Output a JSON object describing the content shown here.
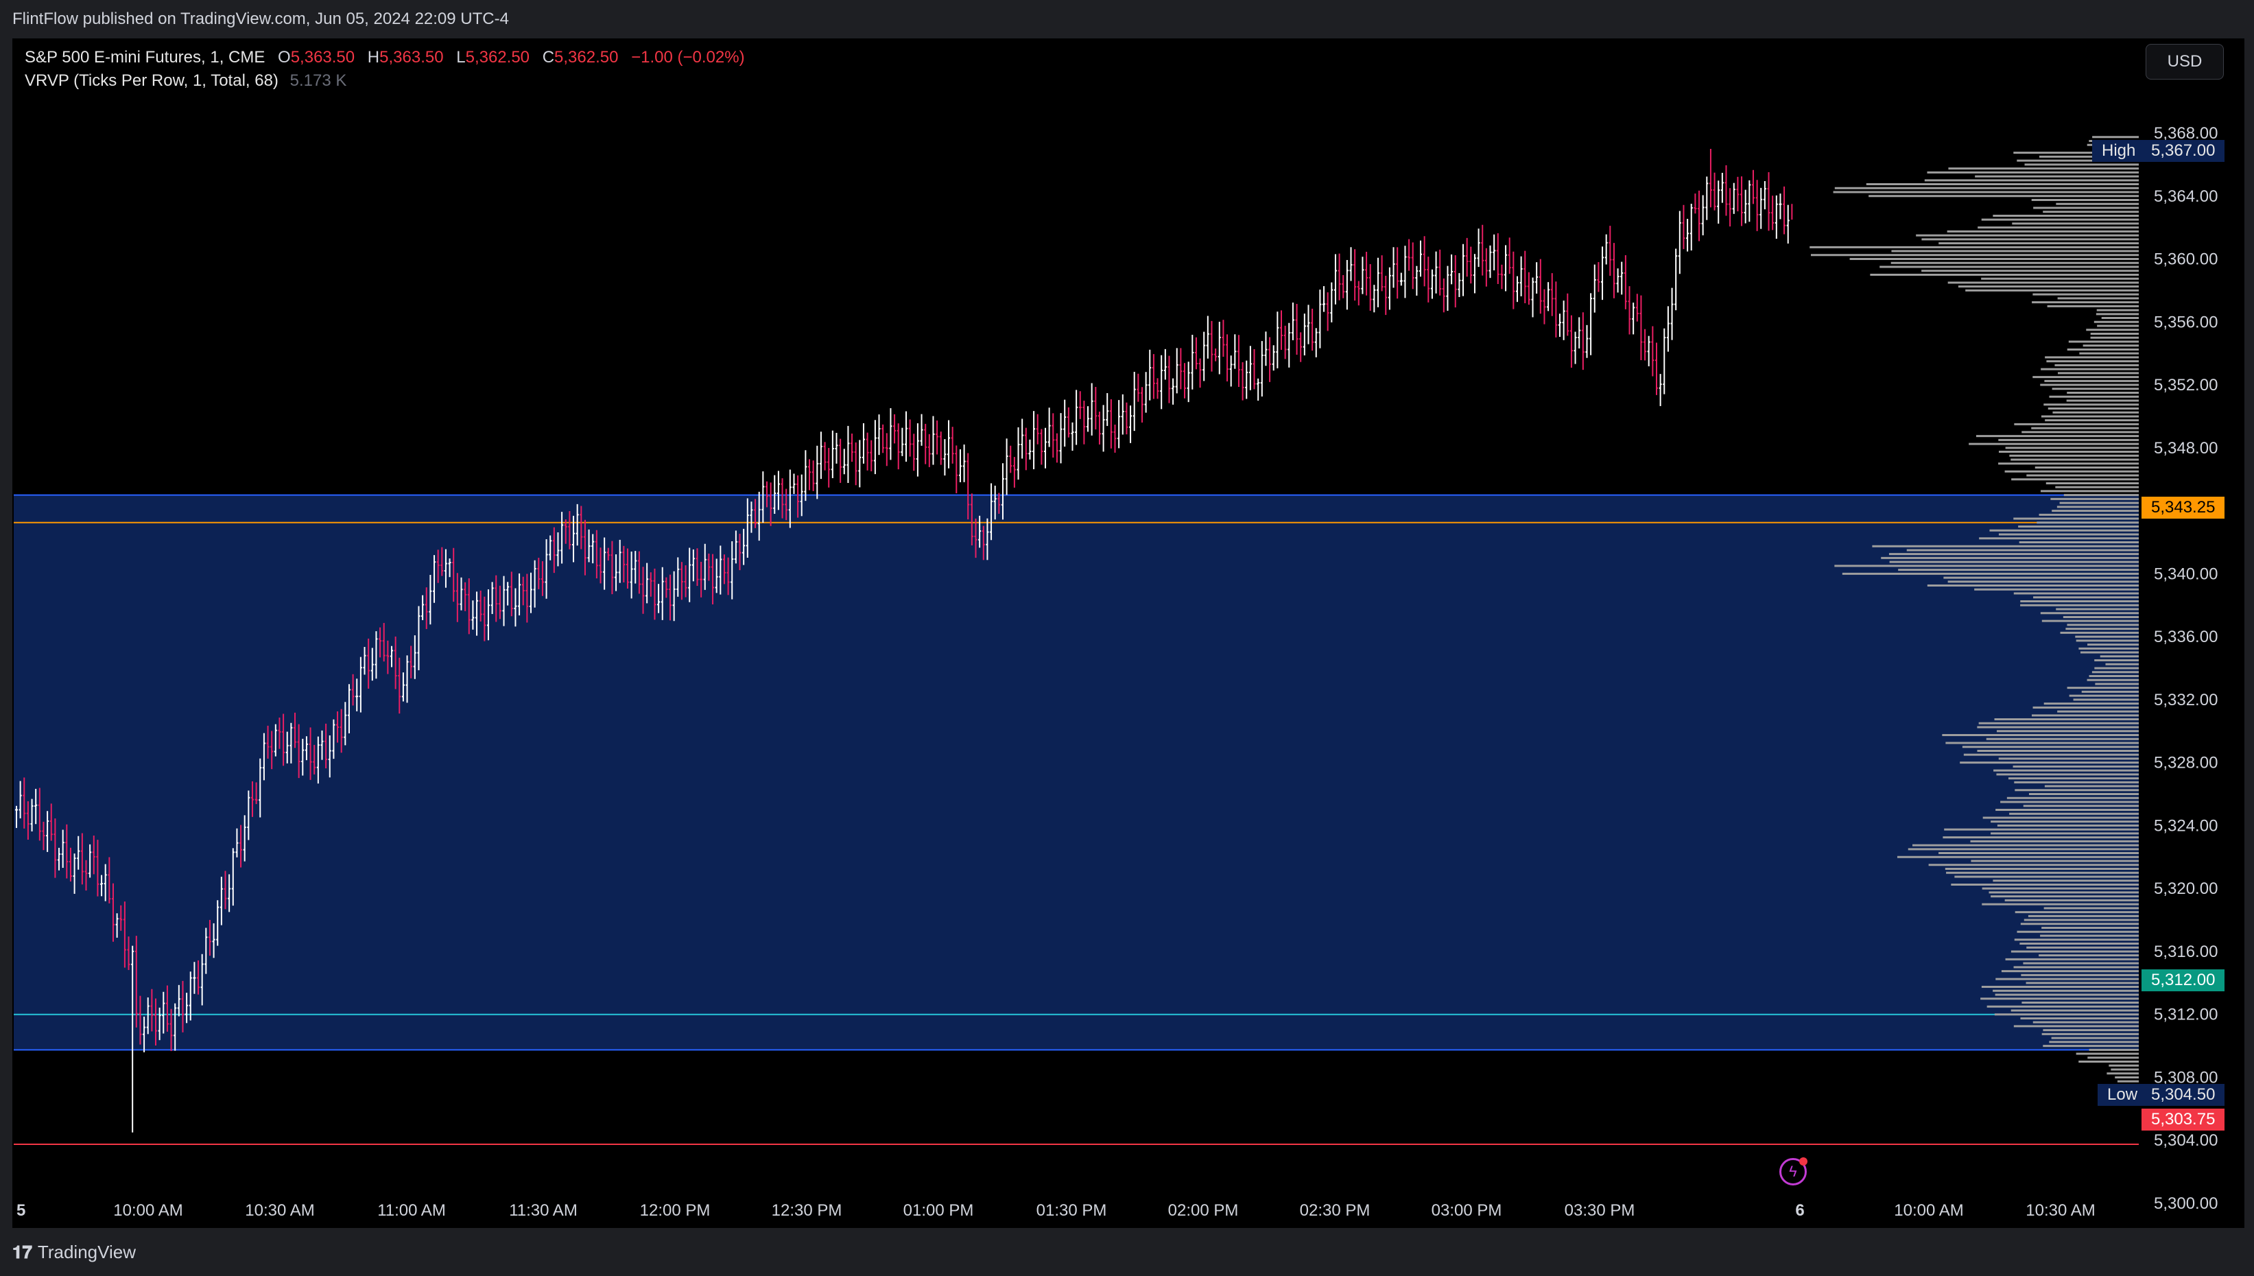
{
  "header": {
    "published_by": "FlintFlow published on TradingView.com, Jun 05, 2024 22:09 UTC-4"
  },
  "legend": {
    "symbol": "S&P 500 E-mini Futures, 1, CME",
    "open_label": "O",
    "open": "5,363.50",
    "high_label": "H",
    "high": "5,363.50",
    "low_label": "L",
    "low": "5,362.50",
    "close_label": "C",
    "close": "5,362.50",
    "change": "−1.00 (−0.02%)",
    "indicator": "VRVP (Ticks Per Row, 1, Total, 68)",
    "indicator_value": "5.173 K"
  },
  "currency_button": "USD",
  "price_labels": {
    "high_tag": "High",
    "high_value": "5,367.00",
    "poc_value": "5,343.25",
    "val_value": "5,312.00",
    "low_tag": "Low",
    "low_value": "5,304.50",
    "last_value": "5,303.75"
  },
  "footer": {
    "brand": "TradingView"
  },
  "colors": {
    "background": "#000000",
    "up": "#ffffff",
    "down": "#e91e63",
    "value_area": "#0c2254",
    "poc": "#ff9800",
    "val_line": "#26c6da",
    "low_line": "#f23645",
    "vol_bar": "#9e9e9e"
  },
  "chart_data": {
    "type": "candlestick",
    "title": "S&P 500 E-mini Futures, 1, CME",
    "interval": "1 minute",
    "y_ticks": [
      5368,
      5364,
      5360,
      5356,
      5352,
      5348,
      5344,
      5340,
      5336,
      5332,
      5328,
      5324,
      5320,
      5316,
      5312,
      5308,
      5304,
      5300
    ],
    "y_tick_labels": [
      "5,368.00",
      "5,364.00",
      "5,360.00",
      "5,356.00",
      "5,352.00",
      "5,348.00",
      "5,344.00",
      "5,340.00",
      "5,336.00",
      "5,332.00",
      "5,328.00",
      "5,324.00",
      "5,320.00",
      "5,316.00",
      "5,312.00",
      "5,308.00",
      "5,304.00",
      "5,300.00"
    ],
    "ylim": [
      5299,
      5370
    ],
    "x_ticks": [
      "5",
      "10:00 AM",
      "10:30 AM",
      "11:00 AM",
      "11:30 AM",
      "12:00 PM",
      "12:30 PM",
      "01:00 PM",
      "01:30 PM",
      "02:00 PM",
      "02:30 PM",
      "03:00 PM",
      "03:30 PM",
      "6",
      "10:00 AM",
      "10:30 AM"
    ],
    "price_path": [
      [
        0,
        5325
      ],
      [
        20,
        5321
      ],
      [
        30,
        5316
      ],
      [
        31,
        5312
      ],
      [
        40,
        5311
      ],
      [
        55,
        5320
      ],
      [
        65,
        5330
      ],
      [
        75,
        5328
      ],
      [
        85,
        5331
      ],
      [
        95,
        5336
      ],
      [
        100,
        5333
      ],
      [
        110,
        5341
      ],
      [
        120,
        5337
      ],
      [
        135,
        5340
      ],
      [
        145,
        5343
      ],
      [
        155,
        5340
      ],
      [
        170,
        5339
      ],
      [
        185,
        5341
      ],
      [
        195,
        5345
      ],
      [
        205,
        5346
      ],
      [
        215,
        5348
      ],
      [
        225,
        5348
      ],
      [
        235,
        5349
      ],
      [
        245,
        5346
      ],
      [
        248,
        5342
      ],
      [
        255,
        5346
      ],
      [
        265,
        5349
      ],
      [
        285,
        5350
      ],
      [
        300,
        5353
      ],
      [
        308,
        5354
      ],
      [
        320,
        5353
      ],
      [
        335,
        5356
      ],
      [
        340,
        5358
      ],
      [
        355,
        5359
      ],
      [
        370,
        5359
      ],
      [
        385,
        5360
      ],
      [
        395,
        5357
      ],
      [
        405,
        5355
      ],
      [
        410,
        5360
      ],
      [
        420,
        5356
      ],
      [
        425,
        5352
      ],
      [
        430,
        5361
      ],
      [
        438,
        5365
      ],
      [
        445,
        5363
      ],
      [
        452,
        5364
      ],
      [
        458,
        5363
      ]
    ],
    "bars": 460,
    "ohlc_last": {
      "open": 5363.5,
      "high": 5363.5,
      "low": 5362.5,
      "close": 5362.5
    },
    "day_high": 5367.0,
    "day_low": 5304.5,
    "volume_profile": {
      "row_size_ticks": 1,
      "total_volume": "5.173 K",
      "poc": 5343.25,
      "value_area_high": 5345.0,
      "value_area_low": 5309.75,
      "profile": [
        [
          5307,
          12
        ],
        [
          5308,
          18
        ],
        [
          5309,
          35
        ],
        [
          5310,
          55
        ],
        [
          5311,
          70
        ],
        [
          5312,
          85
        ],
        [
          5313,
          90
        ],
        [
          5314,
          80
        ],
        [
          5315,
          75
        ],
        [
          5316,
          72
        ],
        [
          5317,
          68
        ],
        [
          5318,
          70
        ],
        [
          5319,
          88
        ],
        [
          5320,
          105
        ],
        [
          5321,
          120
        ],
        [
          5322,
          135
        ],
        [
          5323,
          110
        ],
        [
          5324,
          90
        ],
        [
          5325,
          80
        ],
        [
          5326,
          70
        ],
        [
          5327,
          85
        ],
        [
          5328,
          100
        ],
        [
          5329,
          110
        ],
        [
          5330,
          95
        ],
        [
          5331,
          60
        ],
        [
          5332,
          40
        ],
        [
          5333,
          30
        ],
        [
          5334,
          25
        ],
        [
          5335,
          35
        ],
        [
          5336,
          45
        ],
        [
          5337,
          55
        ],
        [
          5338,
          70
        ],
        [
          5339,
          120
        ],
        [
          5340,
          170
        ],
        [
          5341,
          150
        ],
        [
          5342,
          90
        ],
        [
          5343,
          70
        ],
        [
          5344,
          50
        ],
        [
          5345,
          55
        ],
        [
          5346,
          75
        ],
        [
          5347,
          80
        ],
        [
          5348,
          95
        ],
        [
          5349,
          70
        ],
        [
          5350,
          55
        ],
        [
          5351,
          50
        ],
        [
          5352,
          60
        ],
        [
          5353,
          55
        ],
        [
          5354,
          40
        ],
        [
          5355,
          30
        ],
        [
          5356,
          25
        ],
        [
          5357,
          60
        ],
        [
          5358,
          110
        ],
        [
          5359,
          150
        ],
        [
          5360,
          185
        ],
        [
          5361,
          130
        ],
        [
          5362,
          90
        ],
        [
          5363,
          60
        ],
        [
          5364,
          180
        ],
        [
          5365,
          120
        ],
        [
          5366,
          70
        ],
        [
          5367,
          30
        ]
      ]
    }
  }
}
